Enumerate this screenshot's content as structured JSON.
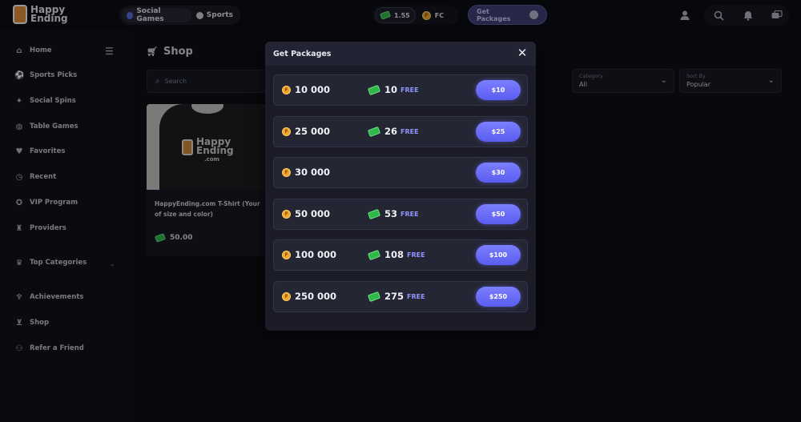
{
  "header": {
    "logo_line1": "Happy",
    "logo_line2": "Ending",
    "tabs": [
      {
        "label": "Social Games"
      },
      {
        "label": "Sports"
      }
    ],
    "wallet_cash": "1.55",
    "wallet_fc": "FC",
    "get_packages_label": "Get Packages"
  },
  "sidebar": {
    "items": [
      {
        "label": "Home",
        "icon": "home-icon"
      },
      {
        "label": "Sports Picks",
        "icon": "sports-icon"
      },
      {
        "label": "Social Spins",
        "icon": "spins-icon"
      },
      {
        "label": "Table Games",
        "icon": "table-games-icon"
      },
      {
        "label": "Favorites",
        "icon": "heart-icon"
      },
      {
        "label": "Recent",
        "icon": "clock-icon"
      },
      {
        "label": "VIP Program",
        "icon": "medal-icon"
      },
      {
        "label": "Providers",
        "icon": "providers-icon"
      },
      {
        "label": "Top Categories",
        "icon": "crown-icon"
      },
      {
        "label": "Achievements",
        "icon": "trophy-icon"
      },
      {
        "label": "Shop",
        "icon": "cart-icon"
      },
      {
        "label": "Refer a Friend",
        "icon": "refer-icon"
      }
    ]
  },
  "main": {
    "title": "Shop",
    "search_placeholder": "Search",
    "category": {
      "label": "Category",
      "value": "All"
    },
    "sort": {
      "label": "Sort By",
      "value": "Popular"
    },
    "product": {
      "title_line1": "HappyEnding.com T-Shirt (Your",
      "title_line2": "of size and color)",
      "price": "50.00",
      "shirt_text1": "Happy",
      "shirt_text2": "Ending",
      "shirt_text3": ".com"
    }
  },
  "modal": {
    "title": "Get Packages",
    "free_label": "FREE",
    "packages": [
      {
        "coins": "10 000",
        "bonus": "10",
        "price": "$10"
      },
      {
        "coins": "25 000",
        "bonus": "26",
        "price": "$25"
      },
      {
        "coins": "30 000",
        "bonus": "",
        "price": "$30"
      },
      {
        "coins": "50 000",
        "bonus": "53",
        "price": "$50"
      },
      {
        "coins": "100 000",
        "bonus": "108",
        "price": "$100"
      },
      {
        "coins": "250 000",
        "bonus": "275",
        "price": "$250"
      }
    ]
  },
  "colors": {
    "accent": "#6b6dfa",
    "background": "#0d0e15",
    "modal": "#1b1c27",
    "free_text": "#8f94ff"
  }
}
